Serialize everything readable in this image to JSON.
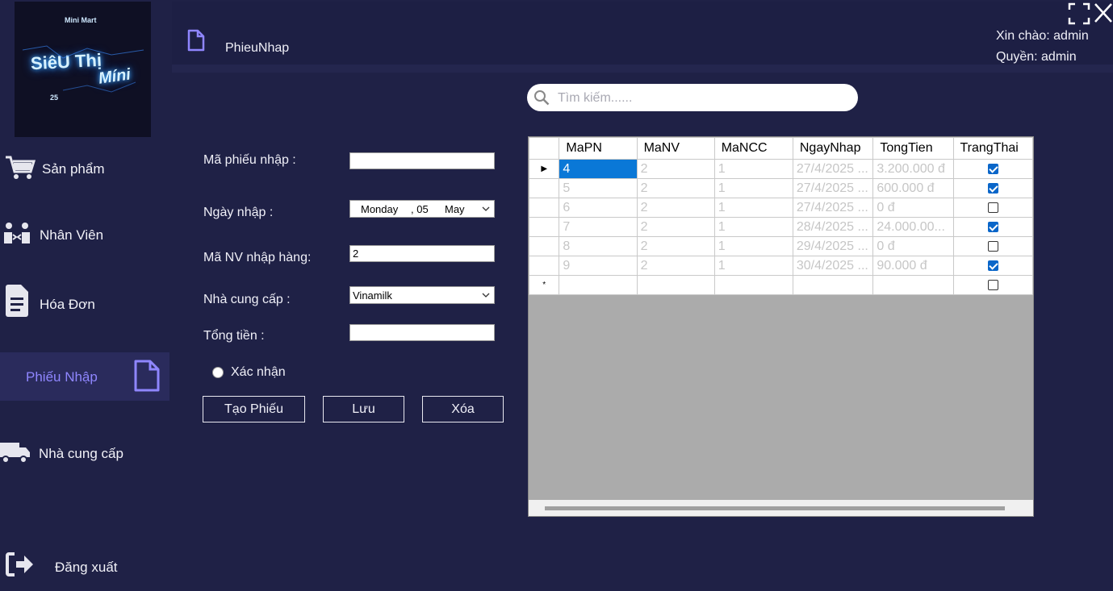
{
  "logo": {
    "top": "Mini Mart",
    "line1": "SiêU Thị",
    "line2": "Míni",
    "bottom": "25"
  },
  "sidebar": {
    "items": [
      {
        "label": "Sản phẩm",
        "icon": "cart-icon"
      },
      {
        "label": "Nhân Viên",
        "icon": "people-icon"
      },
      {
        "label": "Hóa Đơn",
        "icon": "invoice-icon"
      },
      {
        "label": "Phiếu Nhập",
        "icon": "document-icon",
        "active": true
      },
      {
        "label": "Nhà cung cấp",
        "icon": "truck-icon"
      },
      {
        "label": "Đăng xuất",
        "icon": "logout-icon"
      }
    ]
  },
  "header": {
    "title": "PhieuNhap",
    "greeting": "Xin chào: admin",
    "role": "Quyền: admin"
  },
  "search": {
    "placeholder": "Tìm kiếm......"
  },
  "form": {
    "ma_phieu_label": "Mã phiếu nhập :",
    "ma_phieu_value": "",
    "ngay_label": "Ngày nhập :",
    "ngay_weekday": "Monday",
    "ngay_day": ", 05",
    "ngay_month": "May",
    "ma_nv_label": "Mã NV nhập hàng:",
    "ma_nv_value": "2",
    "ncc_label": "Nhà cung cấp :",
    "ncc_value": "Vinamilk",
    "tong_label": "Tổng tiền :",
    "tong_value": "",
    "confirm_label": "Xác nhận",
    "btn_create": "Tạo Phiếu",
    "btn_save": "Lưu",
    "btn_delete": "Xóa"
  },
  "grid": {
    "columns": [
      "MaPN",
      "MaNV",
      "MaNCC",
      "NgayNhap",
      "TongTien",
      "TrangThai"
    ],
    "rows": [
      {
        "MaPN": "4",
        "MaNV": "2",
        "MaNCC": "1",
        "NgayNhap": "27/4/2025 ...",
        "TongTien": "3.200.000 đ",
        "TrangThai": true
      },
      {
        "MaPN": "5",
        "MaNV": "2",
        "MaNCC": "1",
        "NgayNhap": "27/4/2025 ...",
        "TongTien": "600.000 đ",
        "TrangThai": true
      },
      {
        "MaPN": "6",
        "MaNV": "2",
        "MaNCC": "1",
        "NgayNhap": "27/4/2025 ...",
        "TongTien": "0 đ",
        "TrangThai": false
      },
      {
        "MaPN": "7",
        "MaNV": "2",
        "MaNCC": "1",
        "NgayNhap": "28/4/2025 ...",
        "TongTien": "24.000.00...",
        "TrangThai": true
      },
      {
        "MaPN": "8",
        "MaNV": "2",
        "MaNCC": "1",
        "NgayNhap": "29/4/2025 ...",
        "TongTien": "0 đ",
        "TrangThai": false
      },
      {
        "MaPN": "9",
        "MaNV": "2",
        "MaNCC": "1",
        "NgayNhap": "30/4/2025 ...",
        "TongTien": "90.000 đ",
        "TrangThai": true
      }
    ]
  }
}
